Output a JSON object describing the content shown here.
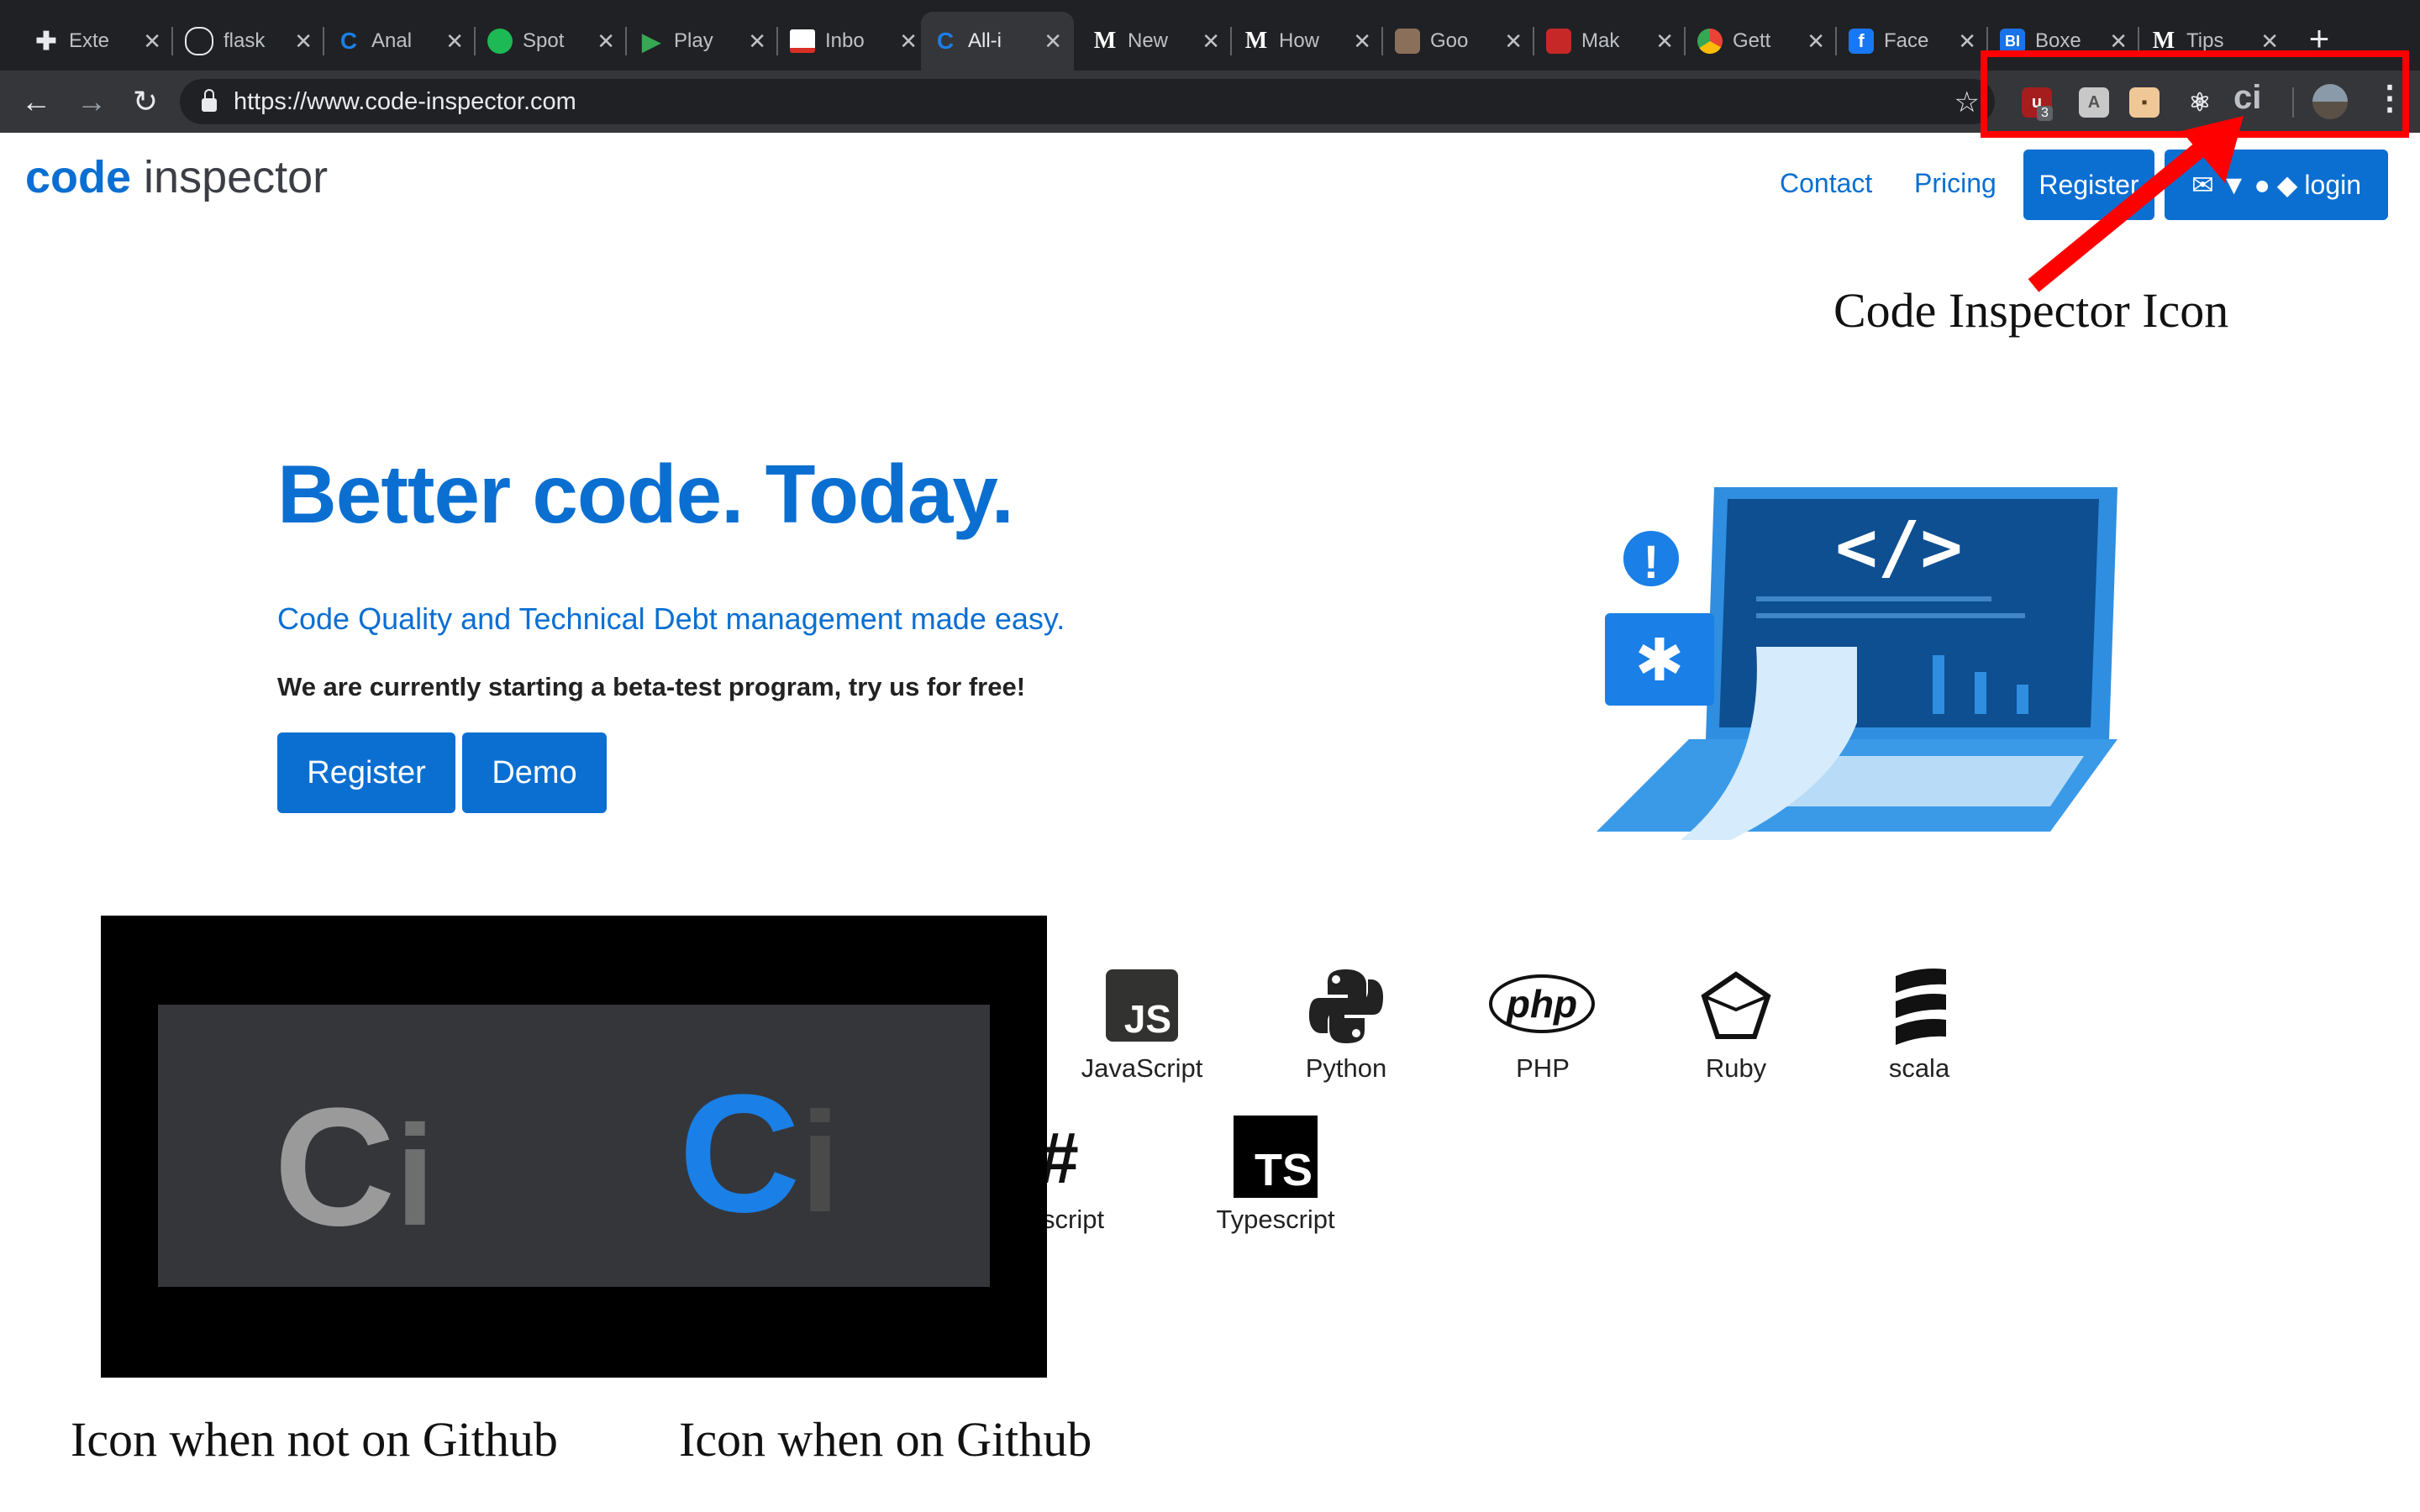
{
  "tabs": [
    {
      "title": "Exte",
      "icon": "puzzle-icon",
      "color": "#5f6368"
    },
    {
      "title": "flask",
      "icon": "github-icon",
      "color": "#202124"
    },
    {
      "title": "Anal",
      "icon": "ci-icon",
      "color": "#0b6fd1"
    },
    {
      "title": "Spot",
      "icon": "spotify-icon",
      "color": "#1db954"
    },
    {
      "title": "Play",
      "icon": "play-icon",
      "color": "#34a853"
    },
    {
      "title": "Inbo",
      "icon": "gmail-icon",
      "color": "#d93025"
    },
    {
      "title": "All-i",
      "icon": "ci-icon",
      "color": "#0b6fd1",
      "active": true
    },
    {
      "title": "New",
      "icon": "medium-icon",
      "color": "#ffffff"
    },
    {
      "title": "How",
      "icon": "medium-icon",
      "color": "#ffffff"
    },
    {
      "title": "Goo",
      "icon": "site-icon",
      "color": "#8a6f5a"
    },
    {
      "title": "Mak",
      "icon": "site-icon",
      "color": "#c62828"
    },
    {
      "title": "Gett",
      "icon": "chrome-icon",
      "color": "#ea4335"
    },
    {
      "title": "Face",
      "icon": "facebook-icon",
      "color": "#1877f2"
    },
    {
      "title": "Boxe",
      "icon": "bl-icon",
      "color": "#1a73e8"
    },
    {
      "title": "Tips",
      "icon": "medium-icon",
      "color": "#ffffff"
    }
  ],
  "tab_glyphs": {
    "ci": "C",
    "medium": "M",
    "facebook": "f",
    "bl": "BI"
  },
  "browser": {
    "url": "https://www.code-inspector.com",
    "extensions_badge": "3",
    "extension_ci": "ci"
  },
  "site": {
    "logo_part1": "code",
    "logo_part2": " inspector",
    "nav": {
      "contact": "Contact",
      "pricing": "Pricing",
      "register": "Register",
      "login": "login"
    }
  },
  "hero": {
    "title": "Better code. Today.",
    "subtitle": "Code Quality and Technical Debt management made easy.",
    "beta": "We are currently starting a beta-test program, try us for free!",
    "register": "Register",
    "demo": "Demo",
    "code_symbol": "</>",
    "alert_symbol": "!"
  },
  "languages": [
    {
      "name": "JavaScript",
      "icon": "javascript-icon",
      "glyph": "JS"
    },
    {
      "name": "Python",
      "icon": "python-icon"
    },
    {
      "name": "PHP",
      "icon": "php-icon",
      "glyph": "php"
    },
    {
      "name": "Ruby",
      "icon": "ruby-icon"
    },
    {
      "name": "scala",
      "icon": "scala-icon"
    },
    {
      "name": "script",
      "icon": "csharp-icon",
      "glyph": "#"
    },
    {
      "name": "Typescript",
      "icon": "typescript-icon",
      "glyph": "TS"
    }
  ],
  "annotations": {
    "code_inspector_icon": "Code Inspector Icon",
    "icon_not_github": "Icon when not on Github",
    "icon_on_github": "Icon when on Github",
    "zoom_letter_c": "C",
    "zoom_letter_i": "i",
    "arrow_color": "#ff0000"
  },
  "colors": {
    "brand_blue": "#0b6fd1",
    "inactive_icon": "#a0a0a0",
    "active_icon": "#1a7fe6"
  }
}
